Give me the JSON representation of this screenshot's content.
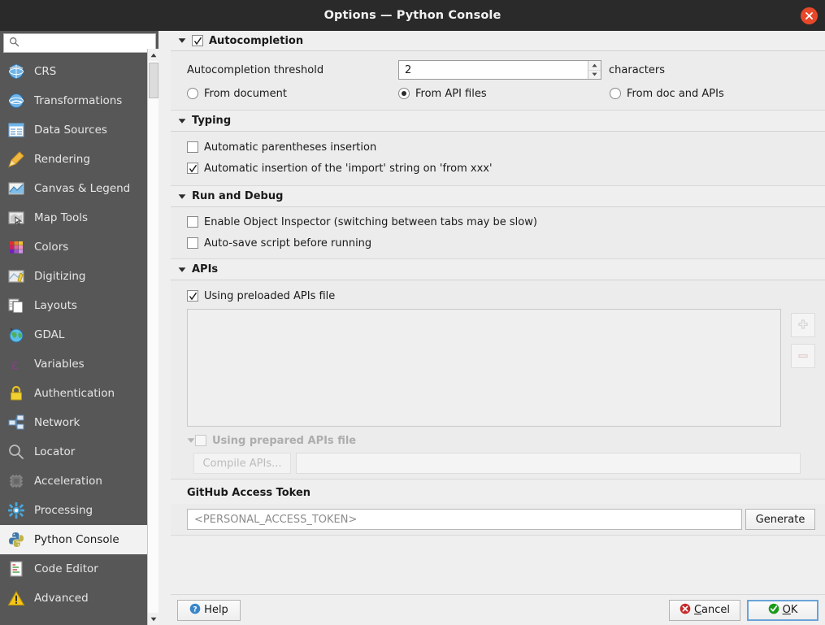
{
  "window": {
    "title": "Options — Python Console",
    "close_label": "Close"
  },
  "sidebar": {
    "search": {
      "placeholder": "",
      "value": ""
    },
    "items": [
      {
        "label": "CRS",
        "icon": "crs-globe-icon"
      },
      {
        "label": "Transformations",
        "icon": "transformations-globe-icon"
      },
      {
        "label": "Data Sources",
        "icon": "data-sources-table-icon"
      },
      {
        "label": "Rendering",
        "icon": "rendering-brush-icon"
      },
      {
        "label": "Canvas & Legend",
        "icon": "canvas-legend-icon"
      },
      {
        "label": "Map Tools",
        "icon": "map-tools-cursor-icon"
      },
      {
        "label": "Colors",
        "icon": "colors-palette-icon"
      },
      {
        "label": "Digitizing",
        "icon": "digitizing-pencil-icon"
      },
      {
        "label": "Layouts",
        "icon": "layouts-pages-icon"
      },
      {
        "label": "GDAL",
        "icon": "gdal-globe-icon"
      },
      {
        "label": "Variables",
        "icon": "variables-epsilon-icon"
      },
      {
        "label": "Authentication",
        "icon": "authentication-lock-icon"
      },
      {
        "label": "Network",
        "icon": "network-nodes-icon"
      },
      {
        "label": "Locator",
        "icon": "locator-magnifier-icon"
      },
      {
        "label": "Acceleration",
        "icon": "acceleration-chip-icon"
      },
      {
        "label": "Processing",
        "icon": "processing-gear-icon"
      },
      {
        "label": "Python Console",
        "icon": "python-console-icon",
        "selected": true
      },
      {
        "label": "Code Editor",
        "icon": "code-editor-icon"
      },
      {
        "label": "Advanced",
        "icon": "advanced-warning-icon"
      }
    ]
  },
  "main": {
    "autocompletion": {
      "header": "Autocompletion",
      "checked": true,
      "threshold_label": "Autocompletion threshold",
      "threshold_value": "2",
      "threshold_suffix": "characters",
      "source_options": [
        {
          "label": "From document",
          "selected": false
        },
        {
          "label": "From API files",
          "selected": true
        },
        {
          "label": "From doc and APIs",
          "selected": false
        }
      ]
    },
    "typing": {
      "header": "Typing",
      "options": [
        {
          "label": "Automatic parentheses insertion",
          "checked": false
        },
        {
          "label": "Automatic insertion of the 'import' string on 'from xxx'",
          "checked": true
        }
      ]
    },
    "run_and_debug": {
      "header": "Run and Debug",
      "options": [
        {
          "label": "Enable Object Inspector (switching between tabs may be slow)",
          "checked": false
        },
        {
          "label": "Auto-save script before running",
          "checked": false
        }
      ]
    },
    "apis": {
      "header": "APIs",
      "preloaded_label": "Using preloaded APIs file",
      "preloaded_checked": true,
      "list_items": [],
      "add_button": "add-api-button",
      "remove_button": "remove-api-button",
      "prepared_label": "Using prepared APIs file",
      "prepared_checked": false,
      "prepared_disabled": true,
      "compile_label": "Compile APIs...",
      "compile_disabled": true,
      "prepared_path_value": "",
      "prepared_path_placeholder": ""
    },
    "github": {
      "label": "GitHub Access Token",
      "token_value": "",
      "token_placeholder": "<PERSONAL_ACCESS_TOKEN>",
      "generate_label": "Generate"
    }
  },
  "buttonbar": {
    "help_label": "Help",
    "cancel_label": "Cancel",
    "ok_label": "OK"
  },
  "colors": {
    "titlebar": "#2a2a2a",
    "close": "#e8482a",
    "sidebar": "#575757",
    "panel": "#efefef",
    "ok_accent": "#1a9a1a",
    "cancel_accent": "#c42b2b",
    "help_accent": "#3a86c8"
  }
}
